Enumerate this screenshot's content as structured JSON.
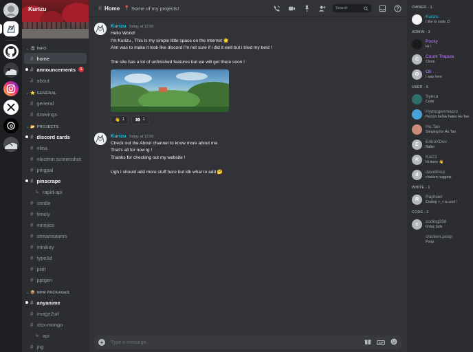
{
  "server": {
    "name": "Kurizu"
  },
  "rail": {
    "servers": [
      {
        "name": "avatar-server-icon"
      },
      {
        "name": "anime-home-server-icon"
      },
      {
        "name": "github-icon"
      },
      {
        "name": "anime-server-icon"
      },
      {
        "name": "instagram-icon"
      },
      {
        "name": "x-icon"
      },
      {
        "name": "threads-icon"
      },
      {
        "name": "anime-server-2-icon"
      }
    ]
  },
  "sidebar": {
    "categories": [
      {
        "label": "INFO",
        "emoji": "📓",
        "channels": [
          {
            "label": "home",
            "state": "active"
          },
          {
            "label": "announcements",
            "state": "unread",
            "badge": "1"
          },
          {
            "label": "about",
            "state": "normal"
          }
        ]
      },
      {
        "label": "GENERAL",
        "emoji": "⭐",
        "channels": [
          {
            "label": "general",
            "state": "normal"
          },
          {
            "label": "drawings",
            "state": "normal"
          }
        ]
      },
      {
        "label": "PROJECTS",
        "emoji": "📂",
        "channels": [
          {
            "label": "discord cards",
            "state": "unread"
          },
          {
            "label": "elina",
            "state": "normal"
          },
          {
            "label": "electron screenshot",
            "state": "normal"
          },
          {
            "label": "pingpal",
            "state": "normal"
          },
          {
            "label": "pinscrape",
            "state": "unread"
          },
          {
            "label": "rapid-api",
            "state": "sub"
          },
          {
            "label": "cordle",
            "state": "normal"
          },
          {
            "label": "timely",
            "state": "normal"
          },
          {
            "label": "emojico",
            "state": "normal"
          },
          {
            "label": "streamsavers",
            "state": "normal"
          },
          {
            "label": "minikey",
            "state": "normal"
          },
          {
            "label": "type3d",
            "state": "normal"
          },
          {
            "label": "pixit",
            "state": "normal"
          },
          {
            "label": "pptgen",
            "state": "normal"
          }
        ]
      },
      {
        "label": "NPM PACKAGES",
        "emoji": "📦",
        "channels": [
          {
            "label": "anyanime",
            "state": "unread"
          },
          {
            "label": "image2url",
            "state": "normal"
          },
          {
            "label": "xlsx-mongo",
            "state": "normal"
          },
          {
            "label": "api",
            "state": "sub"
          },
          {
            "label": "jng",
            "state": "normal"
          }
        ]
      }
    ]
  },
  "header": {
    "channel": "Home",
    "topic_emoji": "📍",
    "topic": "Some of my projects!",
    "search_placeholder": "Search"
  },
  "messages": [
    {
      "author": "Kurizu",
      "time": "Today at 12:00",
      "lines": [
        "Hello World!",
        "I'm Kurizu , This is my simple little space on the internet 🌟",
        "Aim was to make it look like discord i'm not sure if i did it well but i tried my best !",
        "",
        "The site has a lot of unfinished features but we will get there soon !"
      ],
      "reactions": [
        {
          "emoji": "👋",
          "count": "1"
        },
        {
          "emoji": "👀",
          "count": "1"
        }
      ]
    },
    {
      "author": "Kurizu",
      "time": "Today at 12:00",
      "lines": [
        "Check out the About channel to know more about me.",
        "That's all for now ig !",
        "Thanks for checking out my website !",
        "",
        "Ugh I should add more stuff here but idk what to add 🤔"
      ]
    }
  ],
  "composer": {
    "placeholder": "Type a message...",
    "gif_label": "GIF"
  },
  "members": {
    "groups": [
      {
        "label": "OWNER - 1",
        "items": [
          {
            "name": "Kurizu",
            "status": "I like to code :D",
            "name_color": "#23c4e0",
            "avatar_color": "#f2f3f5",
            "initial": ""
          }
        ]
      },
      {
        "label": "ADMIN - 3",
        "items": [
          {
            "name": "Pocky",
            "status": "Hi !",
            "name_color": "#c77dff",
            "avatar_color": "#1a1a1a",
            "initial": ""
          },
          {
            "name": "Count Trapula",
            "status": "Clone",
            "name_color": "#c77dff",
            "avatar_color": "#b5b9bf",
            "initial": "C"
          },
          {
            "name": "Oli",
            "status": "I was here",
            "name_color": "#c77dff",
            "avatar_color": "#b5b9bf",
            "initial": "O"
          }
        ]
      },
      {
        "label": "USER - 6",
        "items": [
          {
            "name": "Syeca",
            "status": "Code",
            "name_color": "#949ba4",
            "avatar_color": "#2e6f6a",
            "initial": ""
          },
          {
            "name": "Hydrogenmacro",
            "status": "Person below hates Hu Tao",
            "name_color": "#949ba4",
            "avatar_color": "#4aa3d8",
            "initial": ""
          },
          {
            "name": "Hu Tao",
            "status": "Simping for Hu Tao",
            "name_color": "#949ba4",
            "avatar_color": "#c98c7a",
            "initial": ""
          },
          {
            "name": "ErikoXDev",
            "status": "Baller",
            "name_color": "#949ba4",
            "avatar_color": "#b5b9bf",
            "initial": "E"
          },
          {
            "name": "Kai21",
            "status": "Hi there 👋",
            "name_color": "#949ba4",
            "avatar_color": "#b5b9bf",
            "initial": "K"
          },
          {
            "name": "davidloop",
            "status": "chicken nuggets",
            "name_color": "#949ba4",
            "avatar_color": "#b5b9bf",
            "initial": "d"
          }
        ]
      },
      {
        "label": "WHITE - 1",
        "items": [
          {
            "name": "Raphael",
            "status": "Coding >_< is cool !",
            "name_color": "#949ba4",
            "avatar_color": "#b5b9bf",
            "initial": "R"
          }
        ]
      },
      {
        "label": "CODE - 2",
        "items": [
          {
            "name": "coding398",
            "status": "G'day lads",
            "name_color": "#949ba4",
            "avatar_color": "#b5b9bf",
            "initial": "c"
          },
          {
            "name": "chicken.poop",
            "status": "Poop",
            "name_color": "#949ba4",
            "avatar_color": "#2b2d31",
            "initial": ""
          }
        ]
      }
    ]
  }
}
